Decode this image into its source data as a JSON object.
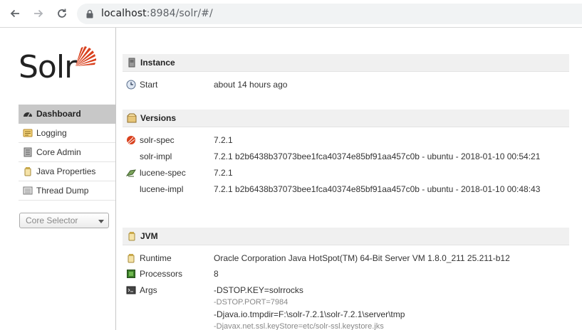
{
  "browser": {
    "url_host": "localhost",
    "url_rest": ":8984/solr/#/"
  },
  "logo": {
    "text": "Solr",
    "color": "#d9411e"
  },
  "nav": {
    "items": [
      {
        "label": "Dashboard",
        "icon": "dashboard-icon",
        "active": true
      },
      {
        "label": "Logging",
        "icon": "logging-icon"
      },
      {
        "label": "Core Admin",
        "icon": "core-admin-icon"
      },
      {
        "label": "Java Properties",
        "icon": "java-properties-icon"
      },
      {
        "label": "Thread Dump",
        "icon": "thread-dump-icon"
      }
    ],
    "core_selector_placeholder": "Core Selector"
  },
  "instance": {
    "title": "Instance",
    "start_label": "Start",
    "start_value": "about 14 hours ago"
  },
  "versions": {
    "title": "Versions",
    "rows": [
      {
        "label": "solr-spec",
        "value": "7.2.1"
      },
      {
        "label": "solr-impl",
        "value": "7.2.1 b2b6438b37073bee1fca40374e85bf91aa457c0b - ubuntu - 2018-01-10 00:54:21"
      },
      {
        "label": "lucene-spec",
        "value": "7.2.1"
      },
      {
        "label": "lucene-impl",
        "value": "7.2.1 b2b6438b37073bee1fca40374e85bf91aa457c0b - ubuntu - 2018-01-10 00:48:43"
      }
    ]
  },
  "jvm": {
    "title": "JVM",
    "runtime_label": "Runtime",
    "runtime_value": "Oracle Corporation Java HotSpot(TM) 64-Bit Server VM 1.8.0_211 25.211-b12",
    "processors_label": "Processors",
    "processors_value": "8",
    "args_label": "Args",
    "args": [
      "-DSTOP.KEY=solrrocks",
      "-DSTOP.PORT=7984",
      "-Djava.io.tmpdir=F:\\solr-7.2.1\\solr-7.2.1\\server\\tmp",
      "-Djavax.net.ssl.keyStore=etc/solr-ssl.keystore.jks"
    ]
  }
}
